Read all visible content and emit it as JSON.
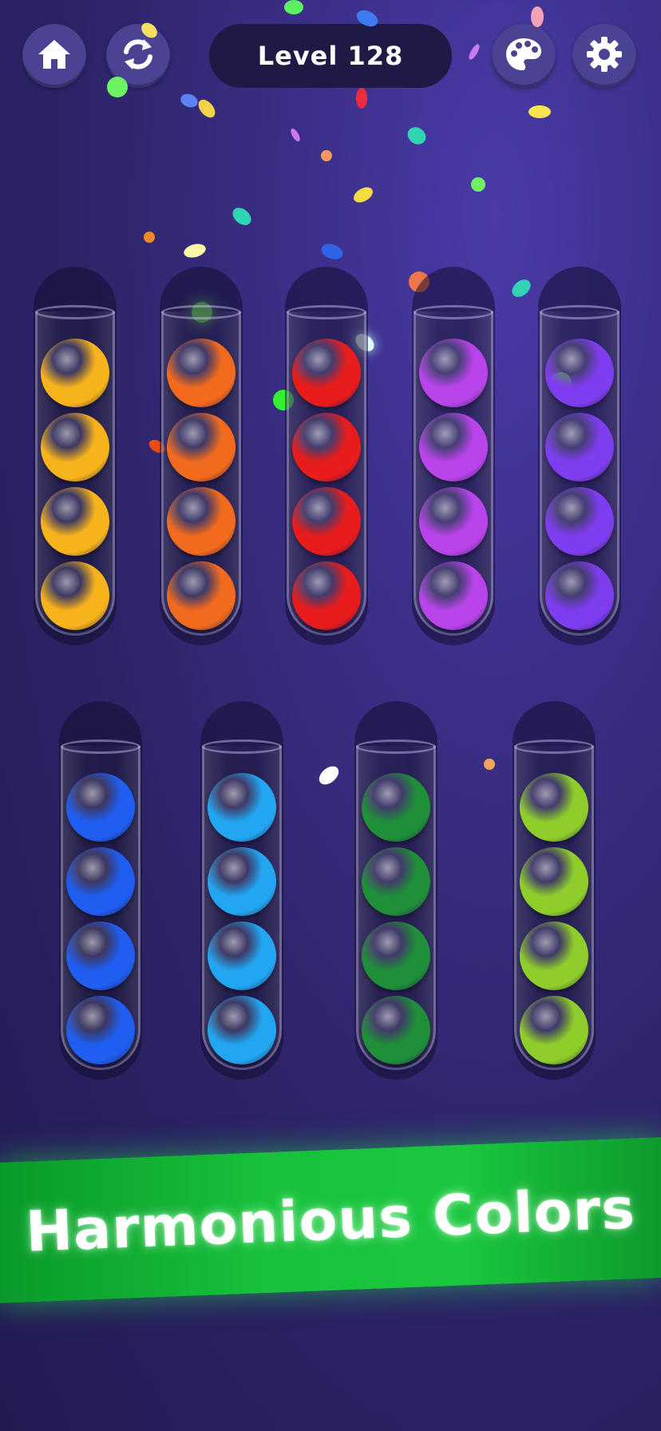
{
  "header": {
    "level_text": "Level 128",
    "buttons": [
      {
        "id": "home",
        "icon": "home-icon"
      },
      {
        "id": "restart",
        "icon": "restart-icon"
      },
      {
        "id": "theme",
        "icon": "palette-icon"
      },
      {
        "id": "settings",
        "icon": "gear-icon"
      }
    ]
  },
  "banner": {
    "text": "Harmonious Colors"
  },
  "colors": {
    "yellow": "#f7b31b",
    "orange": "#f26a1e",
    "red": "#e81c1c",
    "magenta": "#b944ea",
    "violet": "#7f3df0",
    "blue": "#1f5ef0",
    "skyblue": "#22a6f2",
    "green": "#1f8f3a",
    "lime": "#8fce2a"
  },
  "tubes": [
    {
      "balls": [
        "yellow",
        "yellow",
        "yellow",
        "yellow"
      ]
    },
    {
      "balls": [
        "orange",
        "orange",
        "orange",
        "orange"
      ]
    },
    {
      "balls": [
        "red",
        "red",
        "red",
        "red"
      ]
    },
    {
      "balls": [
        "magenta",
        "magenta",
        "magenta",
        "magenta"
      ]
    },
    {
      "balls": [
        "violet",
        "violet",
        "violet",
        "violet"
      ]
    },
    {
      "balls": [
        "blue",
        "blue",
        "blue",
        "blue"
      ]
    },
    {
      "balls": [
        "skyblue",
        "skyblue",
        "skyblue",
        "skyblue"
      ]
    },
    {
      "balls": [
        "green",
        "green",
        "green",
        "green"
      ]
    },
    {
      "balls": [
        "lime",
        "lime",
        "lime",
        "lime"
      ]
    }
  ]
}
